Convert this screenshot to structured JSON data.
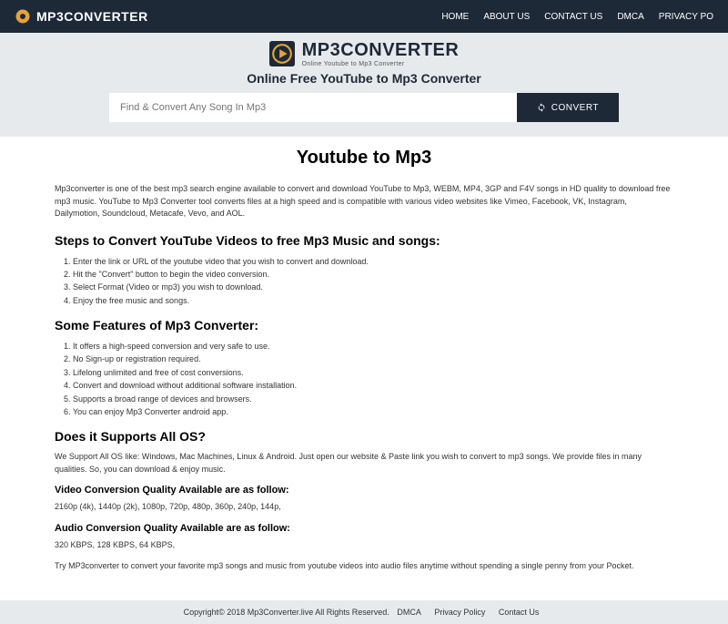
{
  "nav": {
    "brand": "MP3CONVERTER",
    "links": [
      "HOME",
      "ABOUT US",
      "CONTACT US",
      "DMCA",
      "PRIVACY PO"
    ]
  },
  "hero": {
    "logo_main": "MP3CONVERTER",
    "logo_sub": "Online Youtube to Mp3 Converter",
    "title": "Online Free YouTube to Mp3 Converter",
    "search_placeholder": "Find & Convert Any Song In Mp3",
    "convert_label": "CONVERT"
  },
  "content": {
    "main_heading": "Youtube to Mp3",
    "intro": "Mp3converter is one of the best mp3 search engine available to convert and download YouTube to Mp3, WEBM, MP4, 3GP and F4V songs in HD quality to download free mp3 music. YouTube to Mp3 Converter tool converts files at a high speed and is compatible with various video websites like Vimeo, Facebook, VK, Instagram, Dailymotion, Soundcloud, Metacafe, Vevo, and AOL.",
    "steps_heading": "Steps to Convert YouTube Videos to free Mp3 Music and songs:",
    "steps": [
      "Enter the link or URL of the youtube video that you wish to convert and download.",
      "Hit the \"Convert\" button to begin the video conversion.",
      "Select Format (Video or mp3) you wish to download.",
      "Enjoy the free music and songs."
    ],
    "features_heading": "Some Features of Mp3 Converter:",
    "features": [
      "It offers a high-speed conversion and very safe to use.",
      "No Sign-up or registration required.",
      "Lifelong unlimited and free of cost conversions.",
      "Convert and download without additional software installation.",
      "Supports a broad range of devices and browsers.",
      "You can enjoy Mp3 Converter android app."
    ],
    "os_heading": "Does it Supports All OS?",
    "os_text": "We Support All OS like: Windows, Mac Machines, Linux & Android. Just open our website & Paste link you wish to convert to mp3 songs. We provide files in many qualities. So, you can download & enjoy music.",
    "video_heading": "Video Conversion Quality Available are as follow:",
    "video_text": "2160p (4k), 1440p (2k), 1080p, 720p, 480p, 360p, 240p, 144p,",
    "audio_heading": "Audio Conversion Quality Available are as follow:",
    "audio_text": "320 KBPS, 128 KBPS, 64 KBPS,",
    "closing": "Try MP3converter to convert your favorite mp3 songs and music from youtube videos into audio files anytime without spending a single penny from your Pocket."
  },
  "footer": {
    "copyright": "Copyright© 2018 Mp3Converter.live All Rights Reserved.",
    "links": [
      "DMCA",
      "Privacy Policy",
      "Contact Us"
    ]
  }
}
